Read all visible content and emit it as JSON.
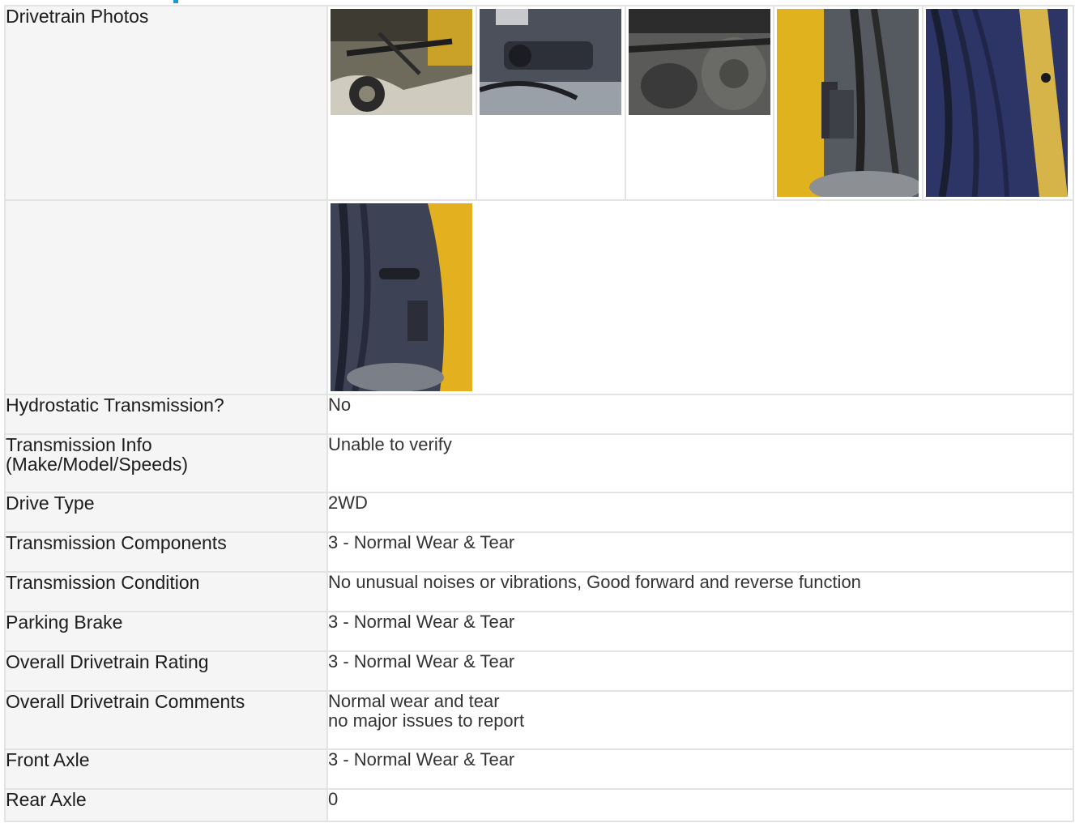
{
  "rows": {
    "drivetrain_photos": {
      "label": "Drivetrain Photos"
    },
    "hydrostatic": {
      "label": "Hydrostatic Transmission?",
      "value": "No"
    },
    "transmission_info": {
      "label_line1": "Transmission Info",
      "label_line2": "(Make/Model/Speeds)",
      "value": "Unable to verify"
    },
    "drive_type": {
      "label": "Drive Type",
      "value": "2WD"
    },
    "transmission_components": {
      "label": "Transmission Components",
      "value": "3 - Normal Wear & Tear"
    },
    "transmission_condition": {
      "label": "Transmission Condition",
      "value": "No unusual noises or vibrations, Good forward and reverse function"
    },
    "parking_brake": {
      "label": "Parking Brake",
      "value": "3 - Normal Wear & Tear"
    },
    "overall_rating": {
      "label": "Overall Drivetrain Rating",
      "value": "3 - Normal Wear & Tear"
    },
    "overall_comments": {
      "label": "Overall Drivetrain Comments",
      "value_line1": "Normal wear and tear",
      "value_line2": "no major issues to report"
    },
    "front_axle": {
      "label": "Front Axle",
      "value": "3 - Normal Wear & Tear"
    },
    "rear_axle": {
      "label": "Rear Axle",
      "value": "0"
    }
  },
  "photos": [
    {
      "name": "drivetrain-photo-1",
      "accent": "#c9a227"
    },
    {
      "name": "drivetrain-photo-2",
      "accent": "#3a3f4a"
    },
    {
      "name": "drivetrain-photo-3",
      "accent": "#4a4a4a"
    },
    {
      "name": "drivetrain-photo-4",
      "accent": "#e0b21e"
    },
    {
      "name": "drivetrain-photo-5",
      "accent": "#2c3566"
    },
    {
      "name": "drivetrain-photo-6",
      "accent": "#e3b01f"
    }
  ],
  "colors": {
    "accent": "#1a9ad6",
    "label_bg": "#f5f5f5",
    "border": "#e3e3e3"
  }
}
